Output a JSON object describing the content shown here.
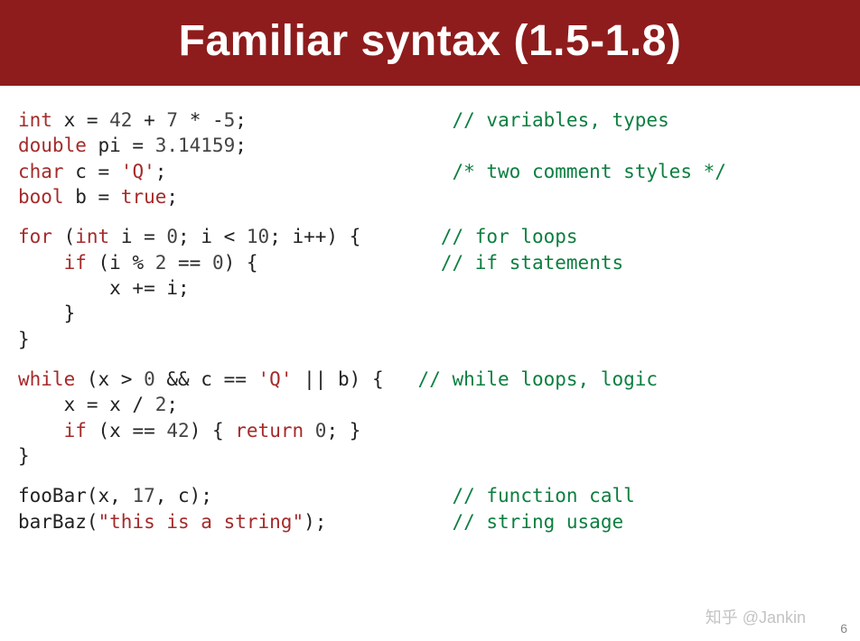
{
  "header": {
    "title": "Familiar syntax (1.5-1.8)"
  },
  "code": {
    "lines": [
      {
        "type": "code",
        "parts": [
          {
            "cls": "kw",
            "text": "int"
          },
          {
            "cls": "",
            "text": " x = "
          },
          {
            "cls": "num",
            "text": "42"
          },
          {
            "cls": "",
            "text": " + "
          },
          {
            "cls": "num",
            "text": "7"
          },
          {
            "cls": "",
            "text": " * -"
          },
          {
            "cls": "num",
            "text": "5"
          },
          {
            "cls": "",
            "text": ";                  "
          },
          {
            "cls": "cmt",
            "text": "// variables, types"
          }
        ]
      },
      {
        "type": "code",
        "parts": [
          {
            "cls": "kw",
            "text": "double"
          },
          {
            "cls": "",
            "text": " pi = "
          },
          {
            "cls": "num",
            "text": "3.14159"
          },
          {
            "cls": "",
            "text": ";"
          }
        ]
      },
      {
        "type": "code",
        "parts": [
          {
            "cls": "kw",
            "text": "char"
          },
          {
            "cls": "",
            "text": " c = "
          },
          {
            "cls": "str",
            "text": "'Q'"
          },
          {
            "cls": "",
            "text": ";                         "
          },
          {
            "cls": "cmt",
            "text": "/* two comment styles */"
          }
        ]
      },
      {
        "type": "code",
        "parts": [
          {
            "cls": "kw",
            "text": "bool"
          },
          {
            "cls": "",
            "text": " b = "
          },
          {
            "cls": "kw",
            "text": "true"
          },
          {
            "cls": "",
            "text": ";"
          }
        ]
      },
      {
        "type": "blank"
      },
      {
        "type": "code",
        "parts": [
          {
            "cls": "kw",
            "text": "for"
          },
          {
            "cls": "",
            "text": " ("
          },
          {
            "cls": "kw",
            "text": "int"
          },
          {
            "cls": "",
            "text": " i = "
          },
          {
            "cls": "num",
            "text": "0"
          },
          {
            "cls": "",
            "text": "; i < "
          },
          {
            "cls": "num",
            "text": "10"
          },
          {
            "cls": "",
            "text": "; i++) {       "
          },
          {
            "cls": "cmt",
            "text": "// for loops"
          }
        ]
      },
      {
        "type": "code",
        "parts": [
          {
            "cls": "",
            "text": "    "
          },
          {
            "cls": "kw",
            "text": "if"
          },
          {
            "cls": "",
            "text": " (i % "
          },
          {
            "cls": "num",
            "text": "2"
          },
          {
            "cls": "",
            "text": " == "
          },
          {
            "cls": "num",
            "text": "0"
          },
          {
            "cls": "",
            "text": ") {                "
          },
          {
            "cls": "cmt",
            "text": "// if statements"
          }
        ]
      },
      {
        "type": "code",
        "parts": [
          {
            "cls": "",
            "text": "        x += i;"
          }
        ]
      },
      {
        "type": "code",
        "parts": [
          {
            "cls": "",
            "text": "    }"
          }
        ]
      },
      {
        "type": "code",
        "parts": [
          {
            "cls": "",
            "text": "}"
          }
        ]
      },
      {
        "type": "blank"
      },
      {
        "type": "code",
        "parts": [
          {
            "cls": "kw",
            "text": "while"
          },
          {
            "cls": "",
            "text": " (x > "
          },
          {
            "cls": "num",
            "text": "0"
          },
          {
            "cls": "",
            "text": " && c == "
          },
          {
            "cls": "str",
            "text": "'Q'"
          },
          {
            "cls": "",
            "text": " || b) {   "
          },
          {
            "cls": "cmt",
            "text": "// while loops, logic"
          }
        ]
      },
      {
        "type": "code",
        "parts": [
          {
            "cls": "",
            "text": "    x = x / "
          },
          {
            "cls": "num",
            "text": "2"
          },
          {
            "cls": "",
            "text": ";"
          }
        ]
      },
      {
        "type": "code",
        "parts": [
          {
            "cls": "",
            "text": "    "
          },
          {
            "cls": "kw",
            "text": "if"
          },
          {
            "cls": "",
            "text": " (x == "
          },
          {
            "cls": "num",
            "text": "42"
          },
          {
            "cls": "",
            "text": ") { "
          },
          {
            "cls": "kw",
            "text": "return"
          },
          {
            "cls": "",
            "text": " "
          },
          {
            "cls": "num",
            "text": "0"
          },
          {
            "cls": "",
            "text": "; }"
          }
        ]
      },
      {
        "type": "code",
        "parts": [
          {
            "cls": "",
            "text": "}"
          }
        ]
      },
      {
        "type": "blank"
      },
      {
        "type": "code",
        "parts": [
          {
            "cls": "",
            "text": "fooBar(x, "
          },
          {
            "cls": "num",
            "text": "17"
          },
          {
            "cls": "",
            "text": ", c);                     "
          },
          {
            "cls": "cmt",
            "text": "// function call"
          }
        ]
      },
      {
        "type": "code",
        "parts": [
          {
            "cls": "",
            "text": "barBaz("
          },
          {
            "cls": "str",
            "text": "\"this is a string\""
          },
          {
            "cls": "",
            "text": ");           "
          },
          {
            "cls": "cmt",
            "text": "// string usage"
          }
        ]
      }
    ]
  },
  "footer": {
    "watermark": "知乎 @Jankin",
    "pagenum": "6"
  }
}
